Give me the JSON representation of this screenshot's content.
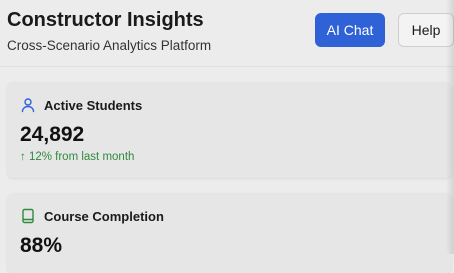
{
  "header": {
    "title": "Constructor Insights",
    "subtitle": "Cross-Scenario Analytics Platform",
    "ai_chat_label": "AI Chat",
    "help_label": "Help"
  },
  "cards": [
    {
      "icon": "user-icon",
      "icon_color": "#2e62d6",
      "label": "Active Students",
      "value": "24,892",
      "trend": "↑ 12% from last month",
      "trend_color": "#2e8b3d"
    },
    {
      "icon": "book-icon",
      "icon_color": "#2e8b3d",
      "label": "Course Completion",
      "value": "88%"
    }
  ],
  "colors": {
    "accent": "#2e62d6",
    "positive": "#2e8b3d",
    "background": "#ececec",
    "card_background": "#e6e6e6"
  }
}
